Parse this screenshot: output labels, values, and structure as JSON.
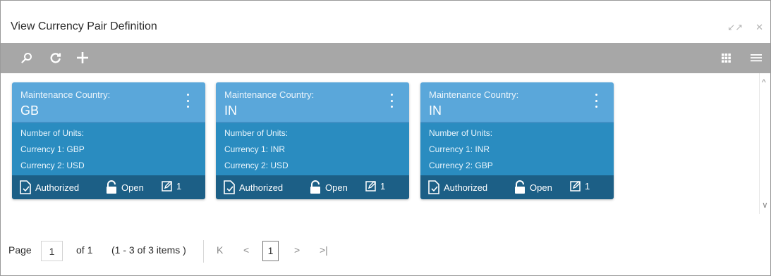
{
  "window": {
    "title": "View Currency Pair Definition",
    "minimize_glyph": "↙↗",
    "close_glyph": "✕"
  },
  "toolbar": {
    "icons": [
      "search-icon",
      "refresh-icon",
      "add-icon",
      "grid-view-icon",
      "list-view-icon"
    ]
  },
  "cards": [
    {
      "country_label": "Maintenance Country:",
      "country": "GB",
      "units_label": "Number of Units:",
      "currency1": "Currency 1:  GBP",
      "currency2": "Currency 2:  USD",
      "auth_status": "Authorized",
      "record_status": "Open",
      "mod_count": "1"
    },
    {
      "country_label": "Maintenance Country:",
      "country": "IN",
      "units_label": "Number of Units:",
      "currency1": "Currency 1:  INR",
      "currency2": "Currency 2:  USD",
      "auth_status": "Authorized",
      "record_status": "Open",
      "mod_count": "1"
    },
    {
      "country_label": "Maintenance Country:",
      "country": "IN",
      "units_label": "Number of Units:",
      "currency1": "Currency 1:  INR",
      "currency2": "Currency 2:  GBP",
      "auth_status": "Authorized",
      "record_status": "Open",
      "mod_count": "1"
    }
  ],
  "pagination": {
    "page_label": "Page",
    "page_value": "1",
    "of_text": "of 1",
    "range_text": "(1 - 3 of 3 items )",
    "current_page": "1",
    "first_glyph": "K",
    "prev_glyph": "<",
    "next_glyph": ">",
    "last_glyph": ">|"
  },
  "colors": {
    "toolbar": "#a7a7a7",
    "card_header": "#5aa7da",
    "card_body": "#2a8cc0",
    "card_footer": "#1c5f86"
  }
}
